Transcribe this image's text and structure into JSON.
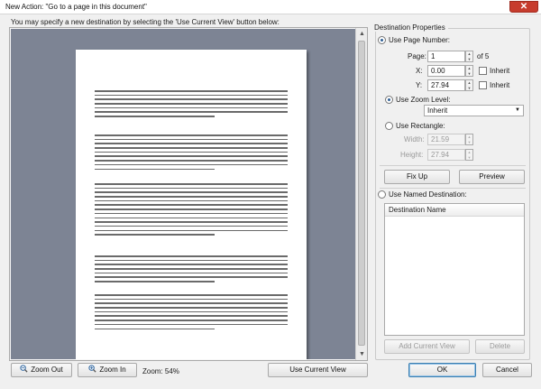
{
  "window": {
    "title": "New Action: \"Go to a page in this document\"",
    "close_icon": "close-icon"
  },
  "instruction": "You may specify a new destination by selecting the 'Use Current View' button below:",
  "preview": {
    "paragraph_lines": [
      7,
      9,
      13,
      7,
      9
    ]
  },
  "toolbar": {
    "zoom_out_label": "Zoom Out",
    "zoom_in_label": "Zoom In",
    "zoom_text": "Zoom: 54%",
    "use_current_view_label": "Use Current View"
  },
  "dest_props": {
    "title": "Destination Properties",
    "use_page_number": "Use Page Number:",
    "page_label": "Page:",
    "page_value": "1",
    "page_of": "of 5",
    "x_label": "X:",
    "x_value": "0.00",
    "y_label": "Y:",
    "y_value": "27.94",
    "inherit_label": "Inherit",
    "use_zoom_level": "Use Zoom Level:",
    "zoom_value": "Inherit",
    "use_rectangle": "Use Rectangle:",
    "width_label": "Width:",
    "width_value": "21.59",
    "height_label": "Height:",
    "height_value": "27.94",
    "fix_up_label": "Fix Up",
    "preview_label": "Preview",
    "use_named_destination": "Use Named Destination:",
    "destination_name_header": "Destination Name",
    "add_current_view_label": "Add Current View",
    "delete_label": "Delete"
  },
  "footer": {
    "ok_label": "OK",
    "cancel_label": "Cancel"
  },
  "colors": {
    "preview_bg": "#7d8494",
    "accent": "#2e5f96",
    "close": "#c73c2d"
  }
}
